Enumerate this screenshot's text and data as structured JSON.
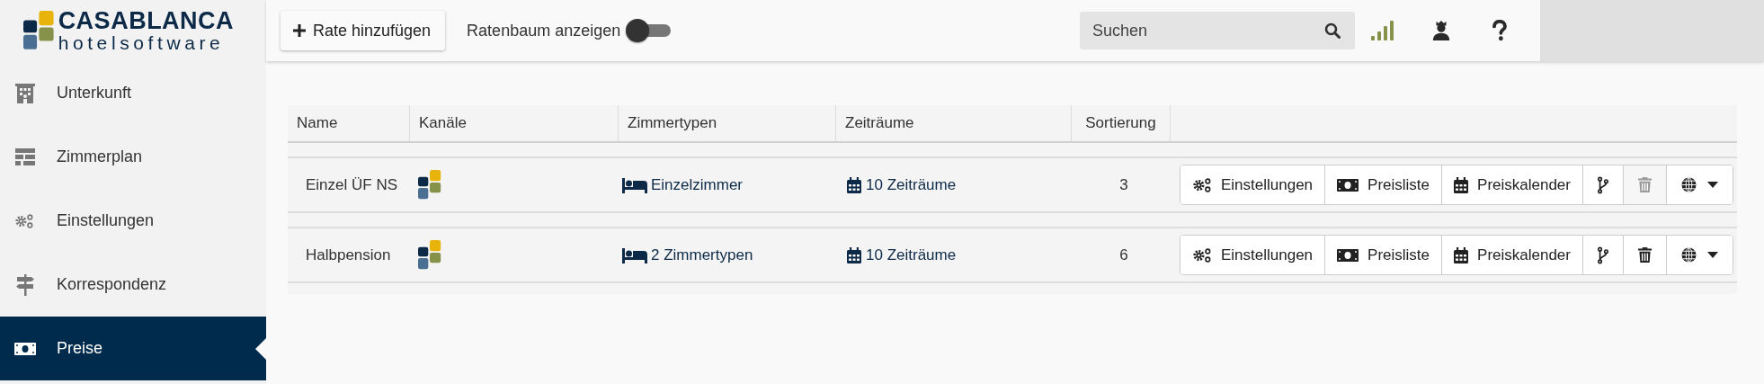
{
  "logo": {
    "name": "CASABLANCA",
    "tagline": "hotelsoftware"
  },
  "sidebar": {
    "items": [
      {
        "label": "Unterkunft",
        "selected": false
      },
      {
        "label": "Zimmerplan",
        "selected": false
      },
      {
        "label": "Einstellungen",
        "selected": false
      },
      {
        "label": "Korrespondenz",
        "selected": false
      },
      {
        "label": "Preise",
        "selected": true
      }
    ]
  },
  "toolbar": {
    "add_button": "Rate hinzufügen",
    "toggle": {
      "label": "Ratenbaum anzeigen",
      "on": false
    },
    "search": {
      "placeholder": "Suchen"
    }
  },
  "table": {
    "columns": [
      "Name",
      "Kanäle",
      "Zimmertypen",
      "Zeiträume",
      "Sortierung"
    ],
    "rows": [
      {
        "name": "Einzel ÜF NS",
        "room_types": "Einzelzimmer",
        "periods": "10 Zeiträume",
        "sort": "3",
        "actions": [
          "Einstellungen",
          "Preisliste",
          "Preiskalender"
        ],
        "delete_disabled": true
      },
      {
        "name": "Halbpension",
        "room_types": "2 Zimmertypen",
        "periods": "10 Zeiträume",
        "sort": "6",
        "actions": [
          "Einstellungen",
          "Preisliste",
          "Preiskalender"
        ],
        "delete_disabled": false
      }
    ]
  }
}
